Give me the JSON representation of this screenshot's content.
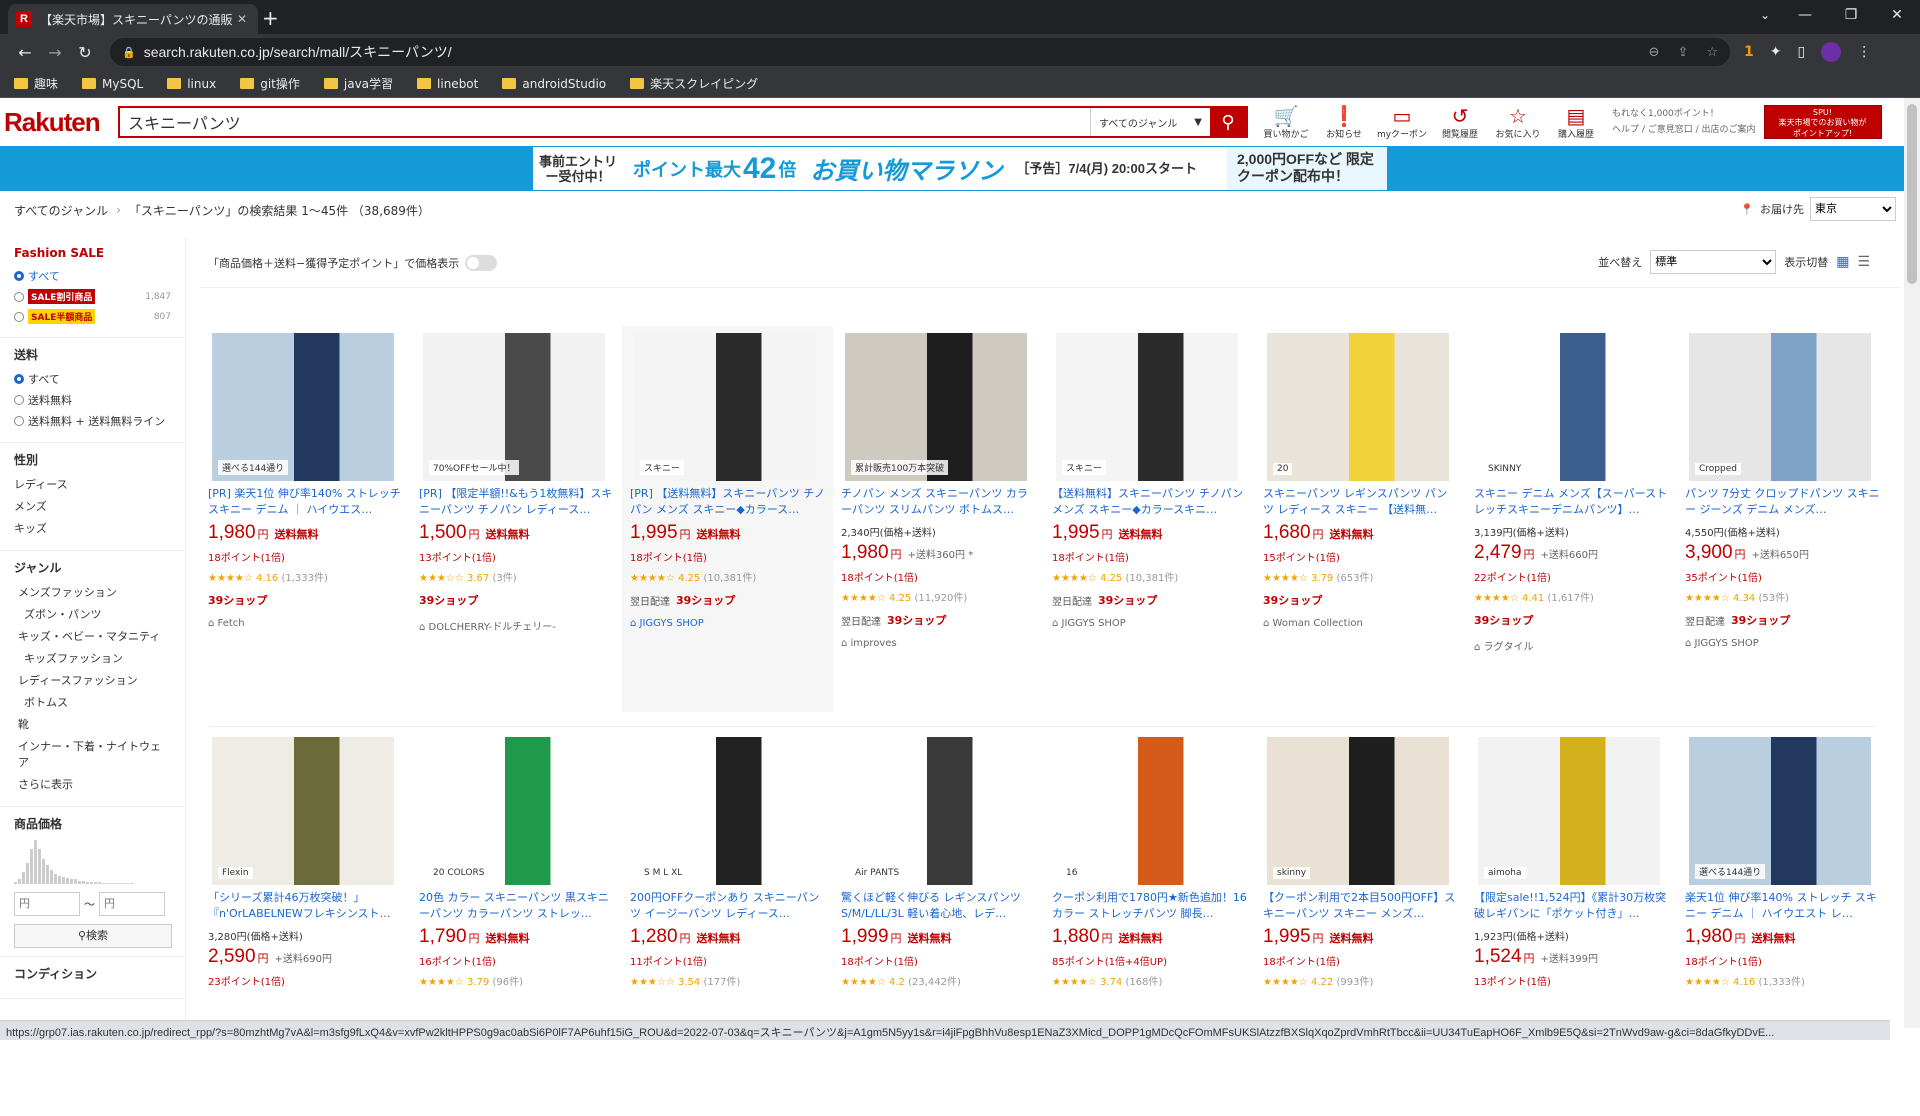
{
  "browser": {
    "tab_title": "【楽天市場】スキニーパンツの通販",
    "tab_favicon": "R",
    "url": "search.rakuten.co.jp/search/mall/スキニーパンツ/",
    "ext_badge": "1",
    "bookmarks": [
      "趣味",
      "MySQL",
      "linux",
      "git操作",
      "java学習",
      "linebot",
      "androidStudio",
      "楽天スクレイピング"
    ]
  },
  "header": {
    "logo": "Rakuten",
    "search_value": "スキニーパンツ",
    "genre_select": "すべてのジャンル",
    "icons": [
      {
        "label": "買い物かご",
        "icon": "cart-icon",
        "glyph": "🛒"
      },
      {
        "label": "お知らせ",
        "icon": "notice-icon",
        "glyph": "❗"
      },
      {
        "label": "myクーポン",
        "icon": "coupon-icon",
        "glyph": "▭"
      },
      {
        "label": "閲覧履歴",
        "icon": "history-icon",
        "glyph": "↺"
      },
      {
        "label": "お気に入り",
        "icon": "star-icon",
        "glyph": "☆"
      },
      {
        "label": "購入履歴",
        "icon": "receipt-icon",
        "glyph": "▤"
      }
    ],
    "links_line1": "もれなく1,000ポイント！",
    "links_line2": "ヘルプ / ご意見窓口 / 出店のご案内",
    "spu_line1": "SPU!",
    "spu_line2": "楽天市場でのお買い物が",
    "spu_line3": "ポイントアップ!"
  },
  "banner": {
    "entry": "事前エントリー受付中！",
    "point_prefix": "ポイント最大",
    "point_value": "42",
    "point_suffix": "倍",
    "event": "お買い物マラソン",
    "notice": "［予告］7/4(月) 20:00スタート",
    "coupon": "2,000円OFFなど 限定クーポン配布中！"
  },
  "breadcrumb": {
    "root": "すべてのジャンル",
    "result": "「スキニーパンツ」の検索結果 1～45件 （38,689件）",
    "deliver_label": "お届け先",
    "deliver_value": "東京"
  },
  "sidebar": {
    "fashion_title": "Fashion SALE",
    "fashion_all": "すべて",
    "fashion_opt1": "SALE割引商品",
    "fashion_opt1_count": "1,847",
    "fashion_opt2": "SALE半額商品",
    "fashion_opt2_count": "807",
    "ship_title": "送料",
    "ship_opts": [
      "すべて",
      "送料無料",
      "送料無料 + 送料無料ライン"
    ],
    "sex_title": "性別",
    "sex_opts": [
      "レディース",
      "メンズ",
      "キッズ"
    ],
    "genre_title": "ジャンル",
    "genre_opts": [
      "メンズファッション",
      "ズボン・パンツ",
      "キッズ・ベビー・マタニティ",
      "キッズファッション",
      "レディースファッション",
      "ボトムス",
      "靴",
      "インナー・下着・ナイトウェア",
      "さらに表示"
    ],
    "price_title": "商品価格",
    "price_min_ph": "円",
    "price_max_ph": "円",
    "price_sep": "～",
    "price_btn": "検索",
    "cond_title": "コンディション",
    "hist": [
      2,
      4,
      10,
      18,
      30,
      38,
      30,
      22,
      16,
      12,
      9,
      7,
      6,
      5,
      4,
      4,
      3,
      3,
      2,
      2,
      2,
      2,
      1,
      1,
      1,
      1,
      1,
      1,
      1,
      1
    ]
  },
  "toolbar": {
    "price_toggle_label": "「商品価格＋送料−獲得予定ポイント」で価格表示",
    "sort_label": "並べ替え",
    "sort_value": "標準",
    "view_label": "表示切替"
  },
  "products_row1": [
    {
      "title": "[PR] 楽天1位 伸び率140% ストレッチ スキニー デニム ｜ ハイウエス…",
      "was": "",
      "price": "1,980",
      "ship": "送料無料",
      "points": "18ポイント(1倍)",
      "rating": "★★★★☆ 4.16",
      "reviews": "(1,333件)",
      "next": "",
      "shop": "Fetch",
      "img_text": "選べる144通り",
      "c1": "#b9cfe0",
      "c2": "#23385f",
      "shop_blue": false
    },
    {
      "title": "[PR] 【限定半額!!&もう1枚無料】スキニーパンツ チノパン レディース…",
      "was": "",
      "price": "1,500",
      "ship": "送料無料",
      "points": "13ポイント(1倍)",
      "rating": "★★★☆☆ 3.67",
      "reviews": "(3件)",
      "next": "",
      "shop": "DOLCHERRY-ドルチェリー-",
      "img_text": "70%OFFセール中！",
      "c1": "#f2f2f2",
      "c2": "#4a4a4a",
      "shop_blue": false
    },
    {
      "title": "[PR] 【送料無料】スキニーパンツ チノパン メンズ スキニー◆カラース…",
      "was": "",
      "price": "1,995",
      "ship": "送料無料",
      "points": "18ポイント(1倍)",
      "rating": "★★★★☆ 4.25",
      "reviews": "(10,381件)",
      "next": "翌日配達",
      "shop": "JIGGYS SHOP",
      "img_text": "スキニー",
      "c1": "#f4f4f4",
      "c2": "#2b2b2b",
      "shop_blue": true
    },
    {
      "title": "チノパン メンズ スキニーパンツ カラーパンツ スリムパンツ ボトムス…",
      "was": "2,340円(価格+送料)",
      "price": "1,980",
      "ship": "+送料360円 *",
      "points": "18ポイント(1倍)",
      "rating": "★★★★☆ 4.25",
      "reviews": "(11,920件)",
      "next": "翌日配達",
      "shop": "improves",
      "img_text": "累計販売100万本突破",
      "c1": "#cfcac0",
      "c2": "#1e1e1e",
      "shop_blue": false
    },
    {
      "title": "【送料無料】スキニーパンツ チノパン メンズ スキニー◆カラースキニ…",
      "was": "",
      "price": "1,995",
      "ship": "送料無料",
      "points": "18ポイント(1倍)",
      "rating": "★★★★☆ 4.25",
      "reviews": "(10,381件)",
      "next": "翌日配達",
      "shop": "JIGGYS SHOP",
      "img_text": "スキニー",
      "c1": "#f4f4f4",
      "c2": "#2b2b2b",
      "shop_blue": false
    },
    {
      "title": "スキニーパンツ レギンスパンツ パンツ レディース スキニー 【送料無…",
      "was": "",
      "price": "1,680",
      "ship": "送料無料",
      "points": "15ポイント(1倍)",
      "rating": "★★★★☆ 3.79",
      "reviews": "(653件)",
      "next": "",
      "shop": "Woman Collection",
      "img_text": "20",
      "c1": "#e9e4da",
      "c2": "#f2d23a",
      "shop_blue": false
    },
    {
      "title": "スキニー デニム メンズ【スーパーストレッチスキニーデニムパンツ】…",
      "was": "3,139円(価格+送料)",
      "price": "2,479",
      "ship": "+送料660円",
      "points": "22ポイント(1倍)",
      "rating": "★★★★☆ 4.41",
      "reviews": "(1,617件)",
      "next": "",
      "shop": "ラグタイル",
      "img_text": "SKINNY",
      "c1": "#ffffff",
      "c2": "#3a5f8f",
      "shop_blue": false
    },
    {
      "title": "パンツ 7分丈 クロップドパンツ スキニー ジーンズ デニム メンズ…",
      "was": "4,550円(価格+送料)",
      "price": "3,900",
      "ship": "+送料650円",
      "points": "35ポイント(1倍)",
      "rating": "★★★★☆ 4.34",
      "reviews": "(53件)",
      "next": "翌日配達",
      "shop": "JIGGYS SHOP",
      "img_text": "Cropped",
      "c1": "#e6e6e6",
      "c2": "#7fa3c6",
      "shop_blue": false
    }
  ],
  "products_row2": [
    {
      "title": "「シリーズ累計46万枚突破！」『n'OrLABELNEWフレキシンスト…",
      "was": "3,280円(価格+送料)",
      "price": "2,590",
      "ship": "+送料690円",
      "points": "23ポイント(1倍)",
      "img_text": "Flexin",
      "c1": "#efece6",
      "c2": "#6b6a3a"
    },
    {
      "title": "20色 カラー スキニーパンツ 黒スキニーパンツ カラーパンツ ストレッ…",
      "was": "",
      "price": "1,790",
      "ship": "送料無料",
      "points": "16ポイント(1倍)",
      "rating": "★★★★☆ 3.79",
      "reviews": "(96件)",
      "img_text": "20 COLORS",
      "c1": "#ffffff",
      "c2": "#1e9a4a"
    },
    {
      "title": "200円OFFクーポンあり スキニーパンツ イージーパンツ レディース…",
      "was": "",
      "price": "1,280",
      "ship": "送料無料",
      "points": "11ポイント(1倍)",
      "rating": "★★★☆☆ 3.54",
      "reviews": "(177件)",
      "img_text": "S M L XL",
      "c1": "#ffffff",
      "c2": "#222222"
    },
    {
      "title": "驚くほど軽く伸びる レギンスパンツ S/M/L/LL/3L 軽い着心地、レデ…",
      "was": "",
      "price": "1,999",
      "ship": "送料無料",
      "points": "18ポイント(1倍)",
      "rating": "★★★★☆ 4.2",
      "reviews": "(23,442件)",
      "img_text": "Air PANTS",
      "c1": "#ffffff",
      "c2": "#3a3a3a"
    },
    {
      "title": "クーポン利用で1780円★新色追加！16カラー ストレッチパンツ 脚長…",
      "was": "",
      "price": "1,880",
      "ship": "送料無料",
      "points": "85ポイント(1倍+4倍UP)",
      "rating": "★★★★☆ 3.74",
      "reviews": "(168件)",
      "img_text": "16",
      "c1": "#ffffff",
      "c2": "#d45b1a"
    },
    {
      "title": "【クーポン利用で2本目500円OFF】スキニーパンツ スキニー メンズ…",
      "was": "",
      "price": "1,995",
      "ship": "送料無料",
      "points": "18ポイント(1倍)",
      "rating": "★★★★☆ 4.22",
      "reviews": "(993件)",
      "img_text": "skinny",
      "c1": "#e8e1d4",
      "c2": "#1f1f1f"
    },
    {
      "title": "【限定sale!!1,524円】《累計30万枚突破レギパンに「ポケット付き」…",
      "was": "1,923円(価格+送料)",
      "price": "1,524",
      "ship": "+送料399円",
      "points": "13ポイント(1倍)",
      "img_text": "aimoha",
      "c1": "#f2f2f2",
      "c2": "#d4b01f"
    },
    {
      "title": "楽天1位 伸び率140% ストレッチ スキニー デニム ｜ ハイウエスト レ…",
      "was": "",
      "price": "1,980",
      "ship": "送料無料",
      "points": "18ポイント(1倍)",
      "rating": "★★★★☆ 4.16",
      "reviews": "(1,333件)",
      "img_text": "選べる144通り",
      "c1": "#b9cfe0",
      "c2": "#23385f"
    }
  ],
  "label_39": "39ショップ",
  "yen": "円",
  "status_url": "https://grp07.ias.rakuten.co.jp/redirect_rpp/?s=80mzhtMg7vA&l=m3sfg9fLxQ4&v=xvfPw2kltHPPS0g9ac0abSi6P0lF7AP6uhf15iG_ROU&d=2022-07-03&q=スキニーパンツ&j=A1gm5N5yy1s&r=i4jiFpgBhhVu8esp1ENaZ3XMicd_DOPP1gMDcQcFOmMFsUKSlAtzzfBXSlqXqoZprdVmhRtTbcc&ii=UU34TuEapHO6F_Xmlb9E5Q&si=2TnWvd9aw-g&ci=8daGfkyDDvE..."
}
